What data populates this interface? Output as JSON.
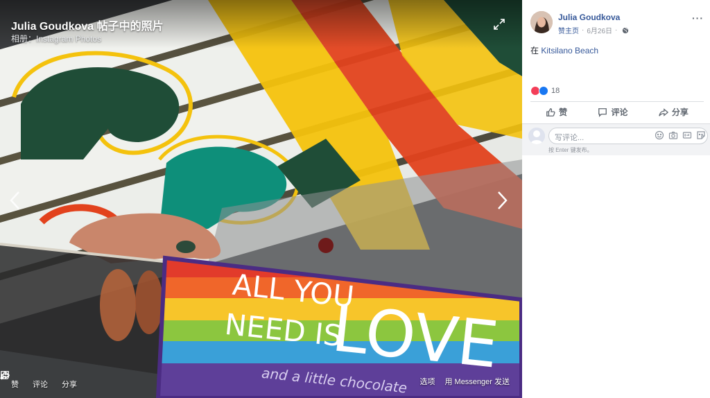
{
  "photo": {
    "title": "Julia Goudkova 帖子中的照片",
    "album_prefix": "相册：",
    "album": "Instagram Photos",
    "actions": {
      "like": "赞",
      "comment": "评论",
      "share": "分享"
    },
    "options": "选项",
    "send_messenger": "用 Messenger 发送",
    "box_text_line1": "ALL YOU",
    "box_text_line2": "NEED IS",
    "box_text_love": "LOVE",
    "box_text_sub": "and a little chocolate"
  },
  "post": {
    "author": "Julia Goudkova",
    "homepage": "赞主页",
    "date": "6月26日",
    "dot": "·",
    "more": "···",
    "location_prefix": "在",
    "location": "Kitsilano Beach",
    "reaction_count": "18",
    "actions": {
      "like": "赞",
      "comment": "评论",
      "share": "分享"
    },
    "comment_placeholder": "写评论...",
    "comment_hint": "按 Enter 键发布。"
  },
  "colors": {
    "link": "#365899",
    "love": "#f33e58",
    "like": "#1877f2",
    "bench_green": "#1f4d37",
    "bench_teal": "#0e8f7a",
    "bench_yellow": "#f4c20d",
    "bench_red": "#e2421d"
  },
  "icons": [
    "expand-icon",
    "chevron-left-icon",
    "chevron-right-icon",
    "like-icon",
    "comment-icon",
    "share-icon",
    "globe-icon",
    "more-icon",
    "emoji-icon",
    "camera-icon",
    "gif-icon",
    "sticker-icon"
  ]
}
